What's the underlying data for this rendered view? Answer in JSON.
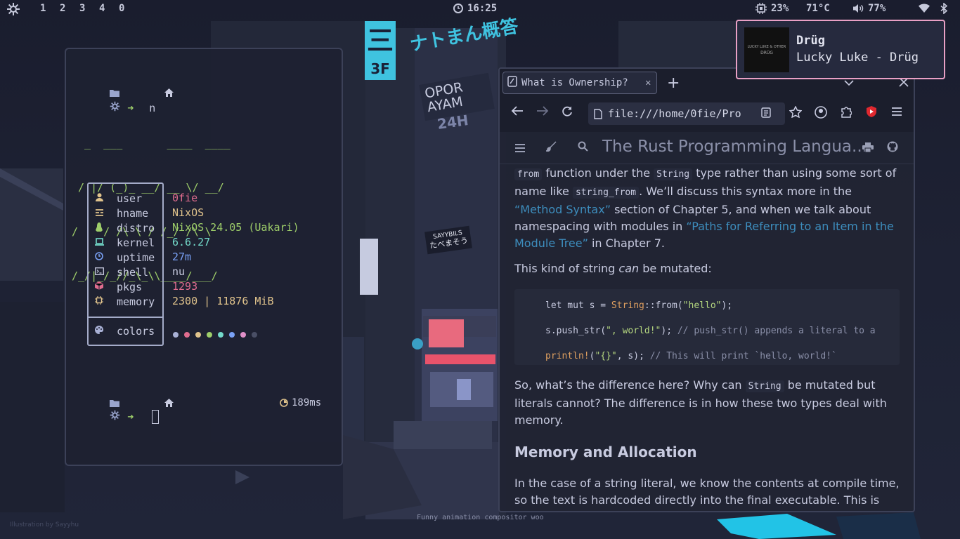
{
  "topbar": {
    "workspaces": [
      "1",
      "2",
      "3",
      "4",
      "0"
    ],
    "clock": "16:25",
    "cpu": "23%",
    "temp": "71°C",
    "volume": "77%",
    "icons": [
      "nixos-snowflake-icon",
      "clock-icon",
      "cpu-icon",
      "volume-icon",
      "wifi-icon",
      "bluetooth-icon"
    ]
  },
  "wallpaper": {
    "credit": "Illustration by Sayyhu",
    "signs": {
      "opor": "OPOR",
      "ayam": "AYAM",
      "hours": "24H",
      "sayybils": "SAYYBILS",
      "jp_small": "たべまそう",
      "jp_big": "ナトまん概答",
      "kanji": "三",
      "sign3f": "3F"
    }
  },
  "caption": "Funny animation compositor woo",
  "terminal": {
    "prompt_arrow": "➜",
    "command": "n",
    "ascii_art": [
      "  _  ___       ____  ____",
      " / |/ (_)_ __/ __ \\/ __/",
      "/    / /\\ \\ / /_/ /\\ \\",
      "/_/|_/_//_\\_\\\\____/___/"
    ],
    "info": [
      {
        "icon": "user-icon",
        "key": "user",
        "value": "0fie",
        "color": "#e06c8e"
      },
      {
        "icon": "hostname-icon",
        "key": "hname",
        "value": "NixOS",
        "color": "#e0c38c"
      },
      {
        "icon": "distro-icon",
        "key": "distro",
        "value": "NixOS 24.05 (Uakari)",
        "color": "#9ece6a"
      },
      {
        "icon": "laptop-icon",
        "key": "kernel",
        "value": "6.6.27",
        "color": "#73daca"
      },
      {
        "icon": "uptime-clock-icon",
        "key": "uptime",
        "value": "27m",
        "color": "#7aa2f7"
      },
      {
        "icon": "terminal-icon",
        "key": "shell",
        "value": "nu",
        "color": "#c8cbe0"
      },
      {
        "icon": "package-icon",
        "key": "pkgs",
        "value": "1293",
        "color": "#e06c8e"
      },
      {
        "icon": "memory-chip-icon",
        "key": "memory",
        "value": "2300 | 11876 MiB",
        "color": "#e0c38c"
      }
    ],
    "colors_label": "colors",
    "color_dots": [
      "#a9b1d6",
      "#e06c8e",
      "#e0c38c",
      "#9ece6a",
      "#73daca",
      "#7aa2f7",
      "#e08fc8",
      "#4a4f66"
    ],
    "timer": "189ms"
  },
  "browser": {
    "tab_title": "What is Ownership?",
    "new_tab": "+",
    "url": "file:///home/0fie/Pro",
    "book_title": "The Rust Programming Langua...",
    "content": {
      "p1_a": "from",
      "p1_b": " function under the ",
      "p1_c": "String",
      "p1_d": " type rather than using some sort of name like ",
      "p1_e": "string_from",
      "p1_f": ". We’ll discuss this syntax more in the ",
      "p1_link1": "“Method Syntax”",
      "p1_g": " section of Chapter 5, and when we talk about namespacing with modules in ",
      "p1_link2": "“Paths for Referring to an Item in the Module Tree”",
      "p1_h": " in Chapter 7.",
      "p2_a": "This kind of string ",
      "p2_em": "can",
      "p2_b": " be mutated:",
      "code_line1": {
        "a": "let mut s = ",
        "b": "String",
        "c": "::from(",
        "d": "\"hello\"",
        "e": ");"
      },
      "code_line2": {
        "a": "s.push_str(",
        "b": "\", world!\"",
        "c": "); ",
        "d": "// push_str() appends a literal to a"
      },
      "code_line3": {
        "a": "println!",
        "b": "(",
        "c": "\"{}\"",
        "d": ", s); ",
        "e": "// This will print `hello, world!`"
      },
      "p3_a": "So, what’s the difference here? Why can ",
      "p3_b": "String",
      "p3_c": " be mutated but literals cannot? The difference is in how these two types deal with memory.",
      "heading": "Memory and Allocation",
      "p4": "In the case of a string literal, we know the contents at compile time, so the text is hardcoded directly into the final executable. This is why string"
    }
  },
  "notification": {
    "title": "Drüg",
    "body": "Lucky Luke - Drüg",
    "album_text_1": "LUCKY LUKE & OTHER",
    "album_text_2": "DRÜG"
  }
}
